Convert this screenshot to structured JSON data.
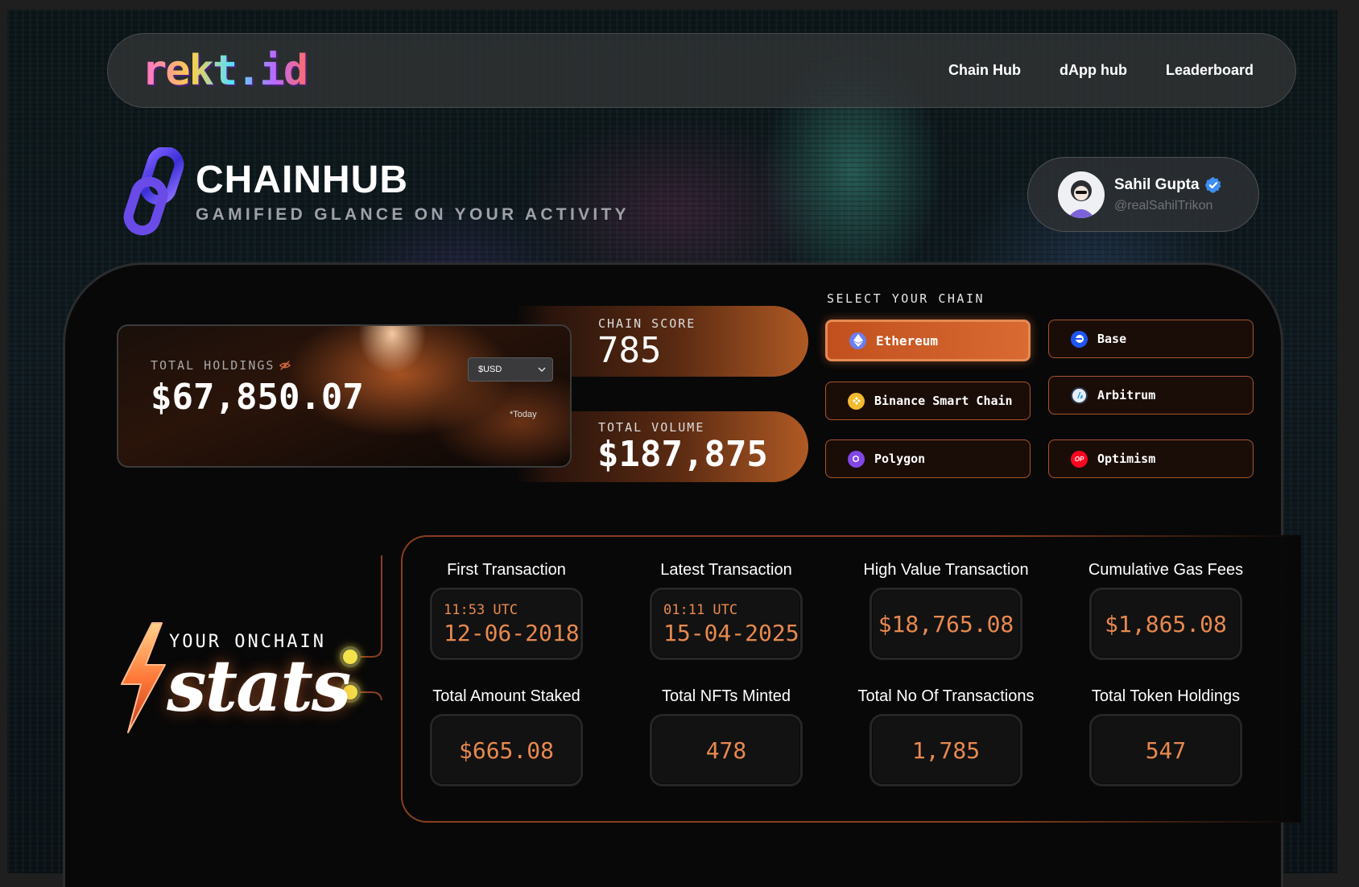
{
  "nav": {
    "logo": "rekt.id",
    "links": [
      "Chain Hub",
      "dApp hub",
      "Leaderboard"
    ]
  },
  "header": {
    "title": "CHAINHUB",
    "subtitle": "GAMIFIED GLANCE ON YOUR ACTIVITY"
  },
  "profile": {
    "name": "Sahil Gupta",
    "handle": "@realSahilTrikon"
  },
  "holdings": {
    "label": "TOTAL HOLDINGS",
    "value": "$67,850.07",
    "currency": "$USD",
    "note": "*Today"
  },
  "score": {
    "label": "CHAIN SCORE",
    "value": "785"
  },
  "volume": {
    "label": "TOTAL VOLUME",
    "value": "$187,875"
  },
  "chain_select": {
    "label": "SELECT YOUR CHAIN",
    "selected": "Ethereum",
    "chains": [
      "Ethereum",
      "Base",
      "Binance Smart Chain",
      "Arbitrum",
      "Polygon",
      "Optimism"
    ]
  },
  "stats": {
    "heading_small": "YOUR ONCHAIN",
    "heading_big": "stats",
    "items": [
      {
        "label": "First Transaction",
        "time": "11:53 UTC",
        "value": "12-06-2018"
      },
      {
        "label": "Latest Transaction",
        "time": "01:11 UTC",
        "value": "15-04-2025"
      },
      {
        "label": "High Value Transaction",
        "value": "$18,765.08"
      },
      {
        "label": "Cumulative Gas Fees",
        "value": "$1,865.08"
      },
      {
        "label": "Total Amount Staked",
        "value": "$665.08"
      },
      {
        "label": "Total NFTs Minted",
        "value": "478"
      },
      {
        "label": "Total No Of Transactions",
        "value": "1,785"
      },
      {
        "label": "Total Token Holdings",
        "value": "547"
      }
    ]
  },
  "colors": {
    "accent": "#d96a32",
    "stat_value": "#e8894f",
    "dot": "#f4e34a"
  }
}
